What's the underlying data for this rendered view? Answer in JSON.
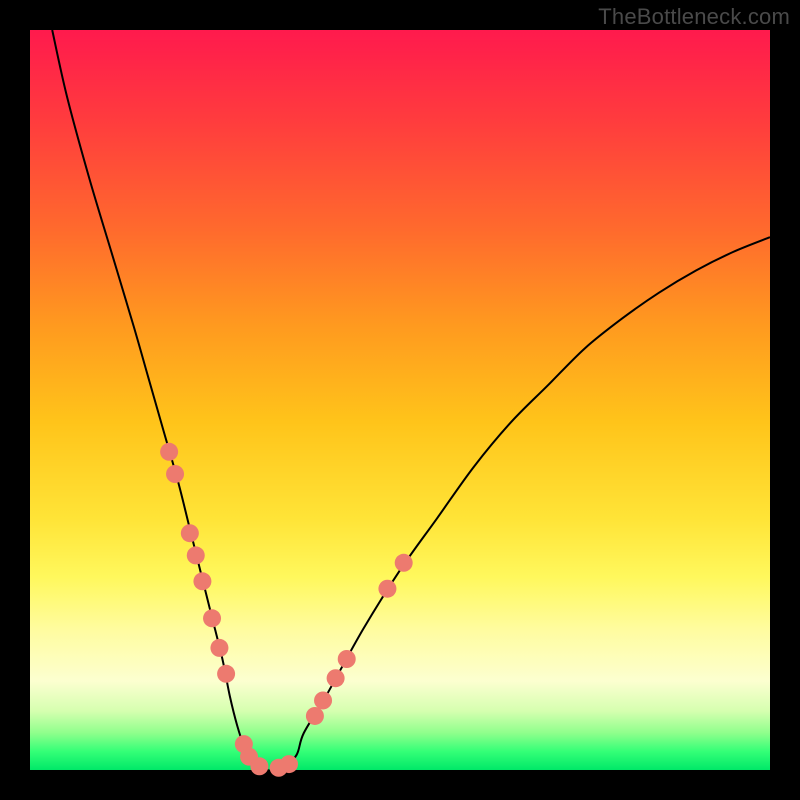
{
  "watermark": "TheBottleneck.com",
  "colors": {
    "frame": "#000000",
    "gradient_top": "#ff1a4d",
    "gradient_bottom": "#00e868",
    "curve": "#000000",
    "dots": "#ed7a6f"
  },
  "chart_data": {
    "type": "line",
    "title": "",
    "xlabel": "",
    "ylabel": "",
    "xlim": [
      0,
      100
    ],
    "ylim": [
      0,
      100
    ],
    "series": [
      {
        "name": "bottleneck-curve",
        "x": [
          3,
          5,
          8,
          11,
          14,
          16,
          18,
          20,
          21.5,
          23,
          24.5,
          26,
          27,
          28,
          29,
          30,
          32,
          34,
          36,
          37,
          40,
          45,
          50,
          55,
          60,
          65,
          70,
          75,
          80,
          85,
          90,
          95,
          100
        ],
        "y": [
          100,
          91,
          80,
          70,
          60,
          53,
          46,
          39,
          33,
          27,
          21,
          15,
          10,
          6,
          3,
          1,
          0,
          0,
          2,
          5,
          10,
          19,
          27,
          34,
          41,
          47,
          52,
          57,
          61,
          64.5,
          67.5,
          70,
          72
        ]
      }
    ],
    "highlight_points": {
      "name": "marked-dots",
      "points": [
        {
          "x": 18.8,
          "y": 43
        },
        {
          "x": 19.6,
          "y": 40
        },
        {
          "x": 21.6,
          "y": 32
        },
        {
          "x": 22.4,
          "y": 29
        },
        {
          "x": 23.3,
          "y": 25.5
        },
        {
          "x": 24.6,
          "y": 20.5
        },
        {
          "x": 25.6,
          "y": 16.5
        },
        {
          "x": 26.5,
          "y": 13
        },
        {
          "x": 28.9,
          "y": 3.5
        },
        {
          "x": 29.6,
          "y": 1.8
        },
        {
          "x": 31.0,
          "y": 0.5
        },
        {
          "x": 33.6,
          "y": 0.3
        },
        {
          "x": 35.0,
          "y": 0.8
        },
        {
          "x": 38.5,
          "y": 7.3
        },
        {
          "x": 39.6,
          "y": 9.4
        },
        {
          "x": 41.3,
          "y": 12.4
        },
        {
          "x": 42.8,
          "y": 15
        },
        {
          "x": 48.3,
          "y": 24.5
        },
        {
          "x": 50.5,
          "y": 28
        }
      ]
    }
  }
}
